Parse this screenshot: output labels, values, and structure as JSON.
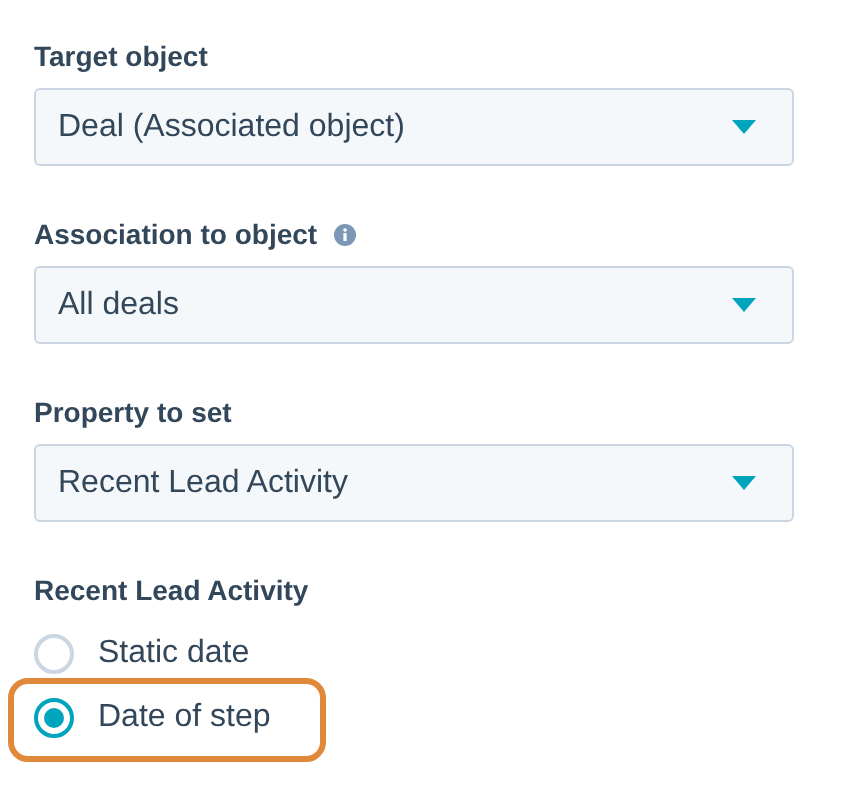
{
  "fields": [
    {
      "label": "Target object",
      "info": false,
      "value": "Deal (Associated object)"
    },
    {
      "label": "Association to object",
      "info": true,
      "value": "All deals"
    },
    {
      "label": "Property to set",
      "info": false,
      "value": "Recent Lead Activity"
    }
  ],
  "radio_group": {
    "label": "Recent Lead Activity",
    "options": [
      {
        "label": "Static date",
        "selected": false,
        "highlighted": false
      },
      {
        "label": "Date of step",
        "selected": true,
        "highlighted": true
      }
    ]
  }
}
